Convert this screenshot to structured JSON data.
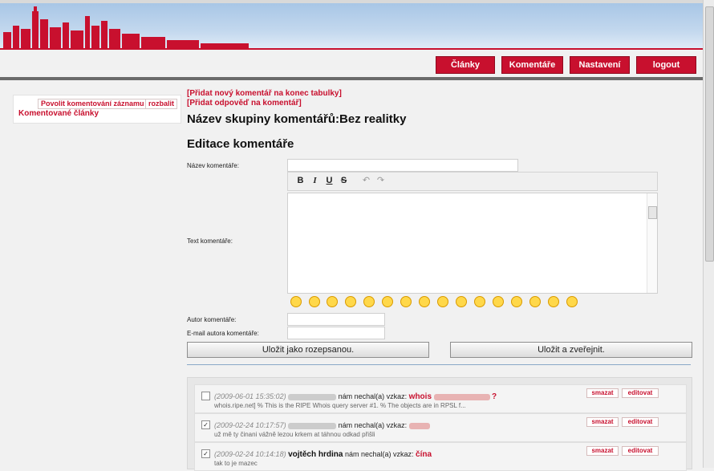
{
  "nav": {
    "items": [
      {
        "label": "Články"
      },
      {
        "label": "Komentáře"
      },
      {
        "label": "Nastavení"
      },
      {
        "label": "logout"
      }
    ]
  },
  "sidebar": {
    "enable_button": "Povolit komentování záznamu",
    "expand_button": "rozbalit",
    "link": "Komentované články"
  },
  "main": {
    "link_add_comment": "[Přidat nový komentář na konec tabulky]",
    "link_add_reply": "[Přidat odpověď na komentář]",
    "group_title": "Název skupiny komentářů:Bez realitky",
    "edit_title": "Editace komentáře"
  },
  "form": {
    "name_label": "Název komentáře:",
    "text_label": "Text komentáře:",
    "author_label": "Autor komentáře:",
    "email_label": "E-mail autora komentáře:",
    "save_draft": "Uložit jako rozepsanou.",
    "save_publish": "Uložit a zveřejnit."
  },
  "toolbar": {
    "bold": "B",
    "italic": "I",
    "underline": "U",
    "strike": "S",
    "undo": "↶",
    "redo": "↷"
  },
  "comments": [
    {
      "date": "(2009-06-01 15:35:02)",
      "verb": "nám nechal(a) vzkaz:",
      "author": "",
      "subject": "whois",
      "subject_suffix": "?",
      "text": "whois.ripe.net] % This is the RIPE Whois query server #1. % The objects are in RPSL f...",
      "checked": false,
      "delete": "smazat",
      "edit": "editovat"
    },
    {
      "date": "(2009-02-24 10:17:57)",
      "verb": "nám nechal(a) vzkaz:",
      "author": "",
      "subject": "",
      "subject_suffix": "",
      "text": "už mě ty činani vážně lezou krkem at táhnou odkad přišli",
      "checked": true,
      "delete": "smazat",
      "edit": "editovat"
    },
    {
      "date": "(2009-02-24 10:14:18)",
      "verb": "nám nechal(a) vzkaz:",
      "author": "vojtěch hrdina",
      "subject": "čína",
      "subject_suffix": "",
      "text": "tak to je mazec",
      "checked": true,
      "delete": "smazat",
      "edit": "editovat"
    }
  ]
}
